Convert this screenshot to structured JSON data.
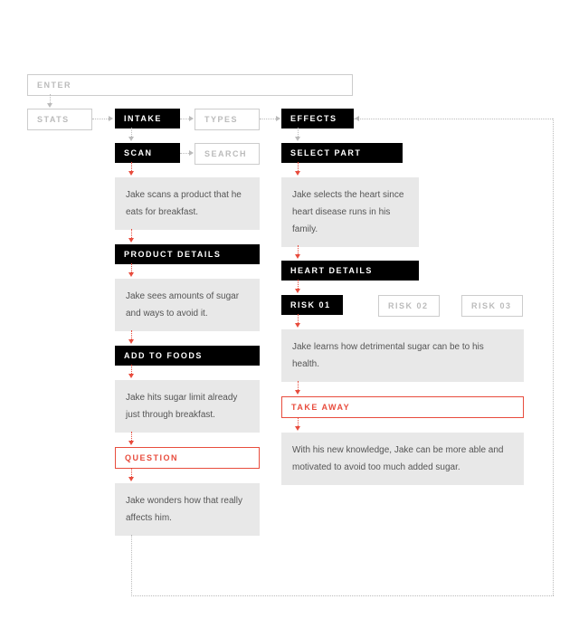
{
  "enter": "ENTER",
  "row1": {
    "stats": "STATS",
    "intake": "INTAKE",
    "types": "TYPES",
    "effects": "EFFECTS"
  },
  "left": {
    "scan": "SCAN",
    "search": "SEARCH",
    "scan_desc": "Jake scans a product that he eats for breakfast.",
    "product_details": "PRODUCT DETAILS",
    "product_desc": "Jake sees amounts of sugar and ways to avoid it.",
    "add_to_foods": "ADD TO FOODS",
    "add_desc": "Jake hits sugar limit already just through breakfast.",
    "question": "QUESTION",
    "question_desc": "Jake wonders how that really affects him."
  },
  "right": {
    "select_part": "SELECT PART",
    "select_desc": "Jake selects the heart since heart disease runs in his family.",
    "heart_details": "HEART DETAILS",
    "risk01": "RISK 01",
    "risk02": "RISK 02",
    "risk03": "RISK 03",
    "risk_desc": "Jake learns how detrimental sugar can be to his health.",
    "take_away": "TAKE AWAY",
    "take_desc": "With his new knowledge, Jake can be more able and motivated to avoid too much added sugar."
  }
}
